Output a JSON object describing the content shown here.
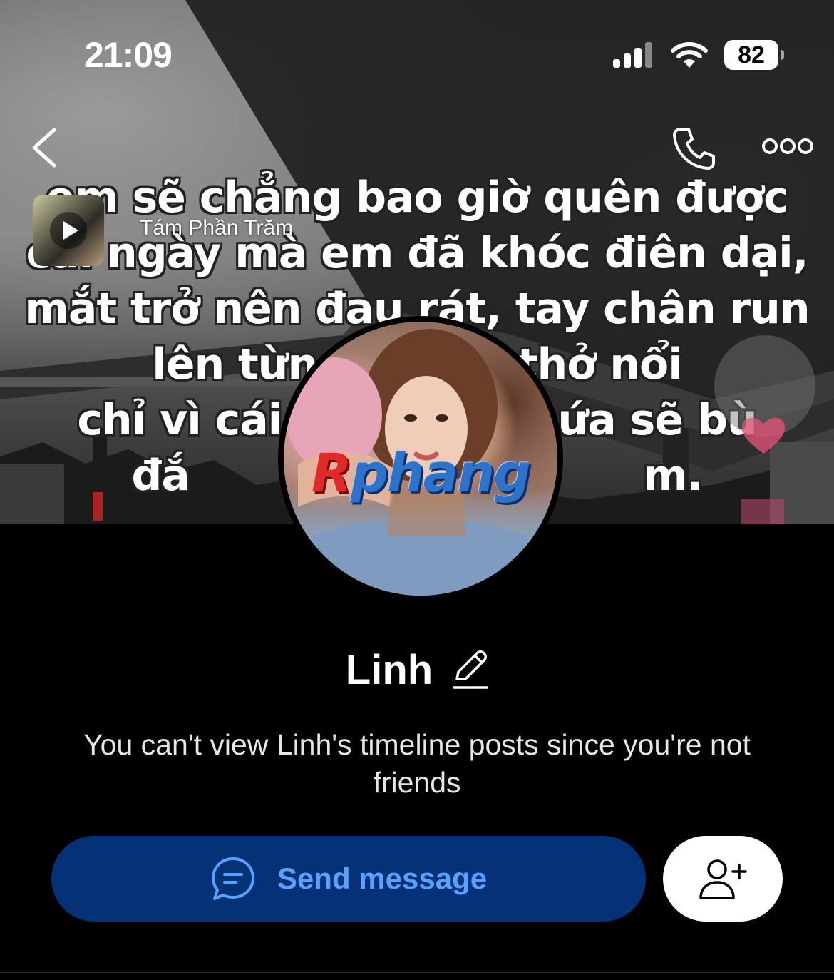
{
  "status_bar": {
    "time": "21:09",
    "battery": "82"
  },
  "nav": {
    "back_icon": "chevron-left-icon",
    "call_icon": "phone-icon",
    "more_icon": "more-horizontal-icon"
  },
  "cover": {
    "lines": [
      "em sẽ chẳng bao giờ quên được",
      "cái ngày mà em đã khóc điên dại,",
      "mắt trở nên đau rát, tay chân run",
      "lên từng            thở nổi",
      "chỉ vì cái tì              hứa sẽ bù",
      "đắ                                m."
    ],
    "music_title": "Tám Phần Trăm"
  },
  "avatar": {
    "watermark_first": "R",
    "watermark_rest": "phang"
  },
  "profile": {
    "name": "Linh",
    "notice": "You can't view Linh's timeline posts since you're not friends"
  },
  "actions": {
    "send_message": "Send message"
  },
  "colors": {
    "send_bg": "#053177",
    "send_text": "#5aa0ff",
    "background": "#000000"
  }
}
